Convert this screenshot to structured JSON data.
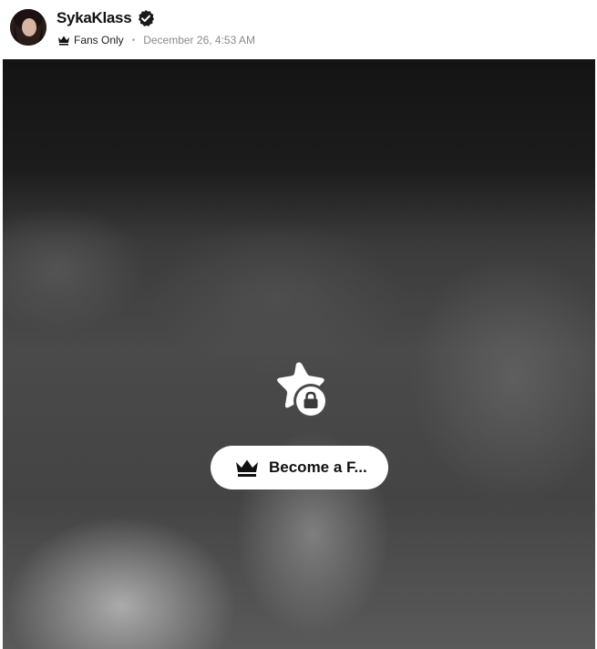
{
  "post": {
    "username": "SykaKlass",
    "verified": true,
    "visibility": "Fans Only",
    "separator": "•",
    "date": "December 26, 4:53 AM"
  },
  "media": {
    "locked": true,
    "icon": "star-lock-icon",
    "cta_label": "Become a F..."
  },
  "icons": {
    "verified": "verified-badge-icon",
    "crown": "crown-icon"
  },
  "colors": {
    "text_primary": "#111111",
    "text_secondary": "#8a8a8a",
    "cta_background": "#ffffff"
  }
}
